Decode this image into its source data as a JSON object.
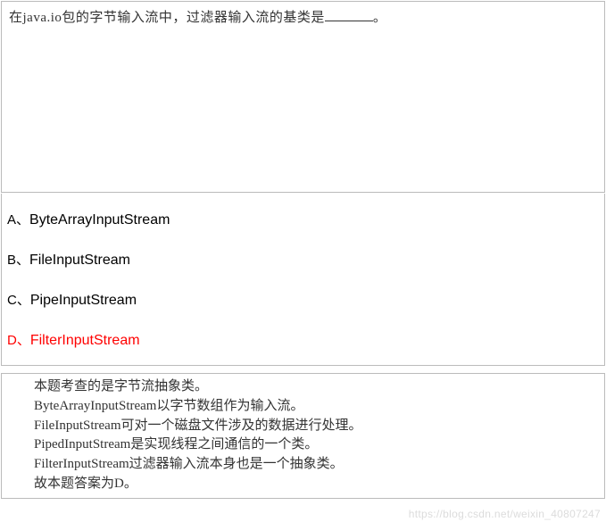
{
  "question": {
    "prefix": "在java.io包的字节输入流中，过滤器输入流的基类是",
    "suffix": "。"
  },
  "answers": [
    {
      "label": "A、",
      "text": "ByteArrayInputStream",
      "correct": false
    },
    {
      "label": "B、",
      "text": "FileInputStream",
      "correct": false
    },
    {
      "label": "C、",
      "text": "PipeInputStream",
      "correct": false
    },
    {
      "label": "D、",
      "text": "FilterInputStream",
      "correct": true
    }
  ],
  "explanation": [
    "本题考查的是字节流抽象类。",
    "ByteArrayInputStream以字节数组作为输入流。",
    "FileInputStream可对一个磁盘文件涉及的数据进行处理。",
    "PipedInputStream是实现线程之间通信的一个类。",
    "FilterInputStream过滤器输入流本身也是一个抽象类。",
    "故本题答案为D。"
  ],
  "watermark": "https://blog.csdn.net/weixin_40807247"
}
